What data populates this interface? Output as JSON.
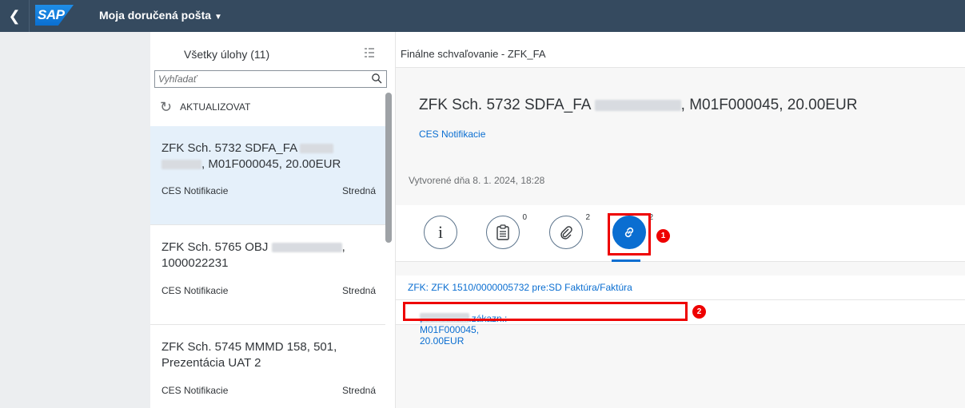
{
  "shell": {
    "back_icon": "chevron-left-icon",
    "logo_text": "SAP",
    "title": "Moja doručená pošta",
    "title_caret": "▼"
  },
  "master": {
    "title": "Všetky úlohy (11)",
    "sort_icon": "sort-list-icon",
    "search": {
      "placeholder": "Vyhľadať",
      "value": ""
    },
    "refresh_label": "AKTUALIZOVAT",
    "items": [
      {
        "title_a": "ZFK Sch. 5732 SDFA_FA",
        "title_b": ", M01F000045, 20.00EUR",
        "source": "CES Notifikacie",
        "priority": "Stredná"
      },
      {
        "title_a": "ZFK Sch. 5765 OBJ",
        "title_b": ",",
        "title_c": "1000022231",
        "source": "CES Notifikacie",
        "priority": "Stredná"
      },
      {
        "title_a": "ZFK Sch. 5745 MMMD 158, 501,",
        "title_b": "Prezentácia UAT 2",
        "source": "CES Notifikacie",
        "priority": "Stredná"
      }
    ]
  },
  "detail": {
    "bar_title": "Finálne schvaľovanie - ZFK_FA",
    "header_title_a": "ZFK Sch. 5732 SDFA_FA",
    "header_title_b": ", M01F000045, 20.00EUR",
    "header_link": "CES Notifikacie",
    "created": "Vytvorené dňa 8. 1. 2024, 18:28",
    "tabs": [
      {
        "icon": "info-icon",
        "count": ""
      },
      {
        "icon": "notes-icon",
        "count": "0"
      },
      {
        "icon": "attachment-icon",
        "count": "2"
      },
      {
        "icon": "link-icon",
        "count": "2"
      }
    ],
    "links": [
      {
        "text": "ZFK: ZFK 1510/0000005732 pre:SD Faktúra/Faktúra"
      },
      {
        "text_a": "Jednotl.fakt.zákazn.:",
        "text_b": ", M01F000045, 20.00EUR"
      }
    ],
    "annotations": [
      "1",
      "2"
    ]
  },
  "colors": {
    "shell": "#354a5f",
    "accent": "#0a6ed1",
    "highlight": "#e00000",
    "selected_row": "#e5f0fa"
  }
}
